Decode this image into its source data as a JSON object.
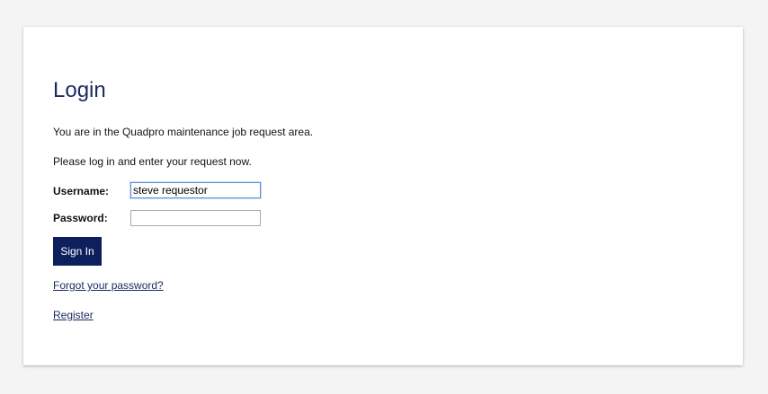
{
  "login": {
    "title": "Login",
    "intro_line_1": "You are in the Quadpro maintenance job request area.",
    "intro_line_2": "Please log in and enter your request now.",
    "username_label": "Username:",
    "username_value": "steve requestor",
    "password_label": "Password:",
    "password_value": "",
    "signin_label": "Sign In",
    "forgot_link": "Forgot your password?",
    "register_link": "Register"
  },
  "colors": {
    "page_background": "#f4f4f4",
    "card_background": "#ffffff",
    "accent": "#0d1f5c",
    "title_color": "#1a2a5e",
    "focus_border": "#5b8fd6"
  }
}
